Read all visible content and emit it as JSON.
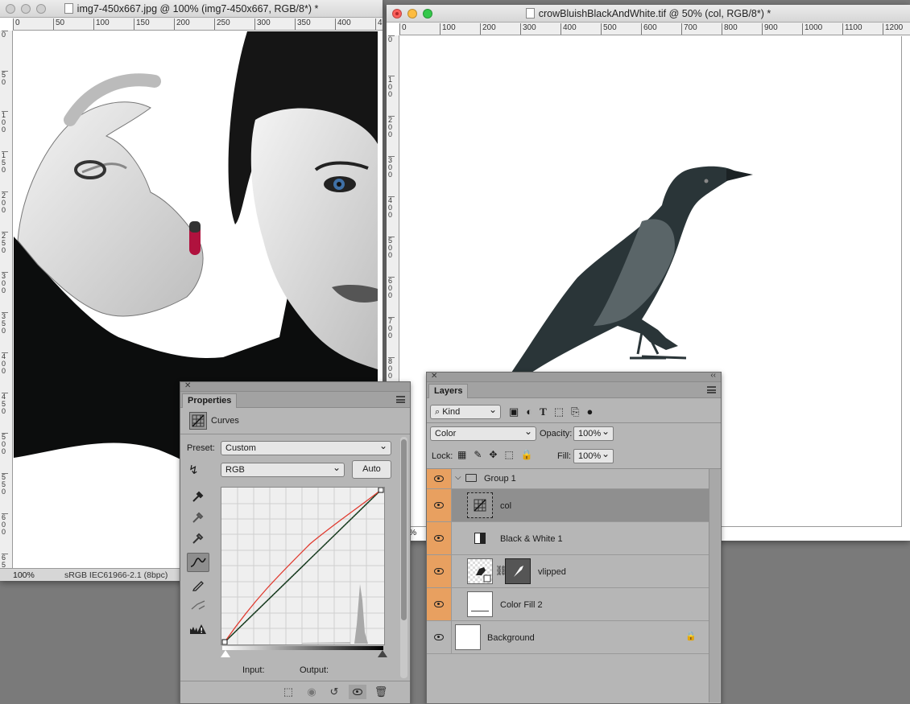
{
  "window_left": {
    "title": "img7-450x667.jpg @ 100% (img7-450x667, RGB/8*) *",
    "ruler_h": [
      "0",
      "50",
      "100",
      "150",
      "200",
      "250",
      "300",
      "350",
      "400",
      "4"
    ],
    "ruler_v": [
      "0",
      "5 0",
      "1 0 0",
      "1 5 0",
      "2 0 0",
      "2 5 0",
      "3 0 0",
      "3 5 0",
      "4 0 0",
      "4 5 0",
      "5 0 0",
      "5 5 0",
      "6 0 0",
      "6 5 0"
    ],
    "zoom": "100%",
    "color_profile": "sRGB IEC61966-2.1 (8bpc)"
  },
  "window_right": {
    "title": "crowBluishBlackAndWhite.tif @ 50% (col, RGB/8*) *",
    "ruler_h": [
      "0",
      "100",
      "200",
      "300",
      "400",
      "500",
      "600",
      "700",
      "800",
      "900",
      "1000",
      "1100",
      "1200"
    ],
    "ruler_v": [
      "0",
      "1 0 0",
      "2 0 0",
      "3 0 0",
      "4 0 0",
      "5 0 0",
      "6 0 0",
      "7 0 0",
      "8 0 0"
    ],
    "zoom_partial": "0%"
  },
  "properties": {
    "tab": "Properties",
    "adjustment": "Curves",
    "preset_label": "Preset:",
    "preset_value": "Custom",
    "channel": "RGB",
    "auto_label": "Auto",
    "input_label": "Input:",
    "output_label": "Output:"
  },
  "layers": {
    "tab": "Layers",
    "filter_kind": "Kind",
    "blend_mode": "Color",
    "opacity_label": "Opacity:",
    "opacity_value": "100%",
    "lock_label": "Lock:",
    "fill_label": "Fill:",
    "fill_value": "100%",
    "items": [
      {
        "name": "Group 1"
      },
      {
        "name": "col"
      },
      {
        "name": "Black & White 1"
      },
      {
        "name": "vlipped"
      },
      {
        "name": "Color Fill 2"
      },
      {
        "name": "Background"
      }
    ]
  },
  "colors": {
    "accent_orange": "#e8a060",
    "selected_row": "#8f8f8f",
    "panel_bg": "#b6b6b6"
  }
}
